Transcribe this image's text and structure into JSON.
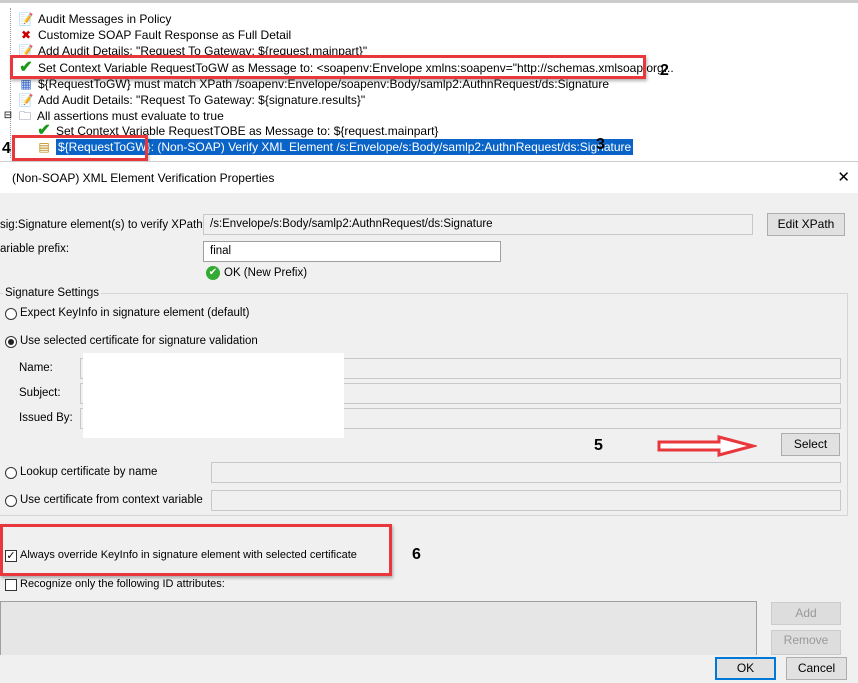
{
  "tree": {
    "items": [
      {
        "label": "Audit Messages in Policy",
        "icon": "audit-icon"
      },
      {
        "label": "Customize SOAP Fault Response as Full Detail",
        "icon": "fault-icon"
      },
      {
        "label": "Add Audit Details: \"Request To Gateway: ${request.mainpart}\"",
        "icon": "audit-icon"
      },
      {
        "label": "Set Context Variable RequestToGW as Message to: <soapenv:Envelope xmlns:soapenv=\"http://schemas.xmlsoap.org...",
        "icon": "check-icon"
      },
      {
        "label": "${RequestToGW} must match XPath /soapenv:Envelope/soapenv:Body/samlp2:AuthnRequest/ds:Signature",
        "icon": "xpath-icon"
      },
      {
        "label": "Add Audit Details: \"Request To Gateway: ${signature.results}\"",
        "icon": "audit-icon"
      },
      {
        "label": "All assertions must evaluate to true",
        "icon": "folder-icon"
      },
      {
        "label": "Set Context Variable RequestTOBE as Message to: ${request.mainpart}",
        "icon": "check-icon"
      },
      {
        "label_var": "${RequestToGW}",
        "label": ": (Non-SOAP) Verify XML Element /s:Envelope/s:Body/samlp2:AuthnRequest/ds:Signature",
        "icon": "verify-icon"
      }
    ],
    "annotations": {
      "n2": "2",
      "n3": "3",
      "n4": "4",
      "n5": "5",
      "n6": "6"
    }
  },
  "dialog": {
    "title": "(Non-SOAP) XML Element Verification Properties",
    "xpath_label": "sig:Signature element(s) to verify XPath:",
    "xpath_value": "/s:Envelope/s:Body/samlp2:AuthnRequest/ds:Signature",
    "edit_xpath": "Edit XPath",
    "prefix_label": "ariable prefix:",
    "prefix_value": "final",
    "prefix_status": "OK (New Prefix)",
    "sig_settings": "Signature Settings",
    "opt_expect": "Expect KeyInfo in signature element (default)",
    "opt_selected": "Use selected certificate for signature validation",
    "name_label": "Name:",
    "subject_label": "Subject:",
    "issued_label": "Issued By:",
    "select": "Select",
    "opt_lookup": "Lookup certificate by name",
    "opt_context": "Use certificate from context variable",
    "override": "Always override KeyInfo in signature element with selected certificate",
    "override_checked": true,
    "recognize": "Recognize only the following ID attributes:",
    "recognize_checked": false,
    "add": "Add",
    "remove": "Remove",
    "ok": "OK",
    "cancel": "Cancel"
  }
}
